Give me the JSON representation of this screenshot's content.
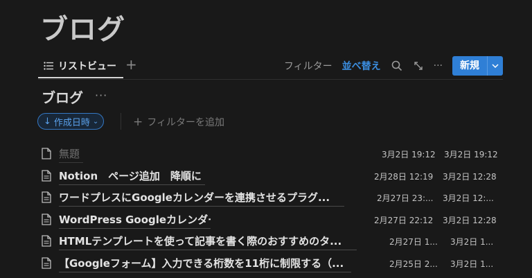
{
  "page": {
    "title": "ブログ"
  },
  "tabs": {
    "active_label": "リストビュー",
    "add_symbol": "+"
  },
  "toolbar": {
    "filter_label": "フィルター",
    "sort_label": "並べ替え",
    "more_symbol": "···",
    "new_label": "新規"
  },
  "database": {
    "title": "ブログ",
    "more_symbol": "···"
  },
  "filters": {
    "chip_label": "作成日時",
    "chip_arrow": "↓",
    "chip_caret": "⌄",
    "add_filter_label": "フィルターを追加",
    "add_filter_symbol": "+"
  },
  "rows": [
    {
      "title": "無題",
      "created": "3月2日 19:12",
      "edited": "3月2日 19:12",
      "empty": true
    },
    {
      "title": "Notion　ページ追加　降順に",
      "created": "2月28日 12:19",
      "edited": "3月2日 12:28"
    },
    {
      "title": "ワードプレスにGoogleカレンダーを連携させるプラグ...",
      "created": "2月27日 23:...",
      "edited": "3月2日 12:..."
    },
    {
      "title": "WordPress Googleカレンダー",
      "created": "2月27日 22:12",
      "edited": "3月2日 12:28"
    },
    {
      "title": "HTMLテンプレートを使って記事を書く際のおすすめのタ...",
      "created": "2月27日 1...",
      "edited": "3月2日 1..."
    },
    {
      "title": "【Googleフォーム】入力できる桁数を11桁に制限する（...",
      "created": "2月25日 2...",
      "edited": "3月2日 1..."
    }
  ],
  "colors": {
    "background": "#191919",
    "accent": "#2f7fd6",
    "sort_text": "#3b8ee0"
  }
}
